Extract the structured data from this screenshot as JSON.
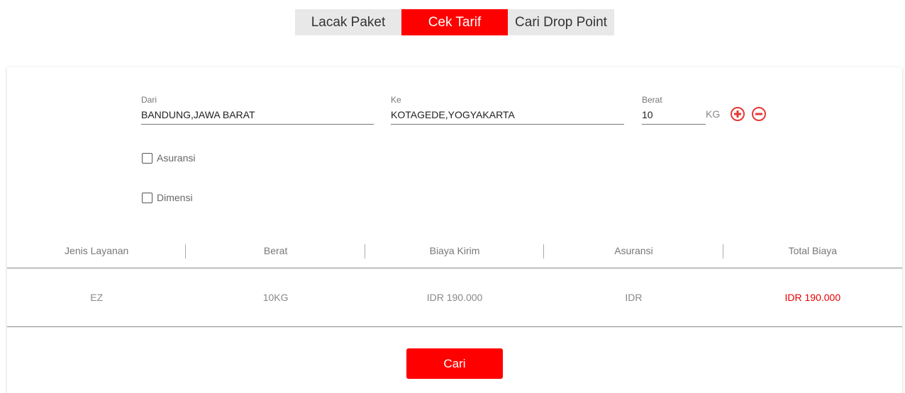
{
  "tabs": [
    {
      "label": "Lacak Paket"
    },
    {
      "label": "Cek Tarif"
    },
    {
      "label": "Cari Drop Point"
    }
  ],
  "form": {
    "dari": {
      "label": "Dari",
      "value": "BANDUNG,JAWA BARAT"
    },
    "ke": {
      "label": "Ke",
      "value": "KOTAGEDE,YOGYAKARTA"
    },
    "berat": {
      "label": "Berat",
      "value": "10",
      "unit": "KG"
    },
    "asuransi_label": "Asuransi",
    "dimensi_label": "Dimensi"
  },
  "table": {
    "headers": [
      "Jenis Layanan",
      "Berat",
      "Biaya Kirim",
      "Asuransi",
      "Total Biaya"
    ],
    "rows": [
      [
        "EZ",
        "10KG",
        "IDR 190.000",
        "IDR",
        "IDR 190.000"
      ]
    ]
  },
  "submit_label": "Cari",
  "colors": {
    "accent": "#ff0000",
    "total_text": "#e60000"
  }
}
